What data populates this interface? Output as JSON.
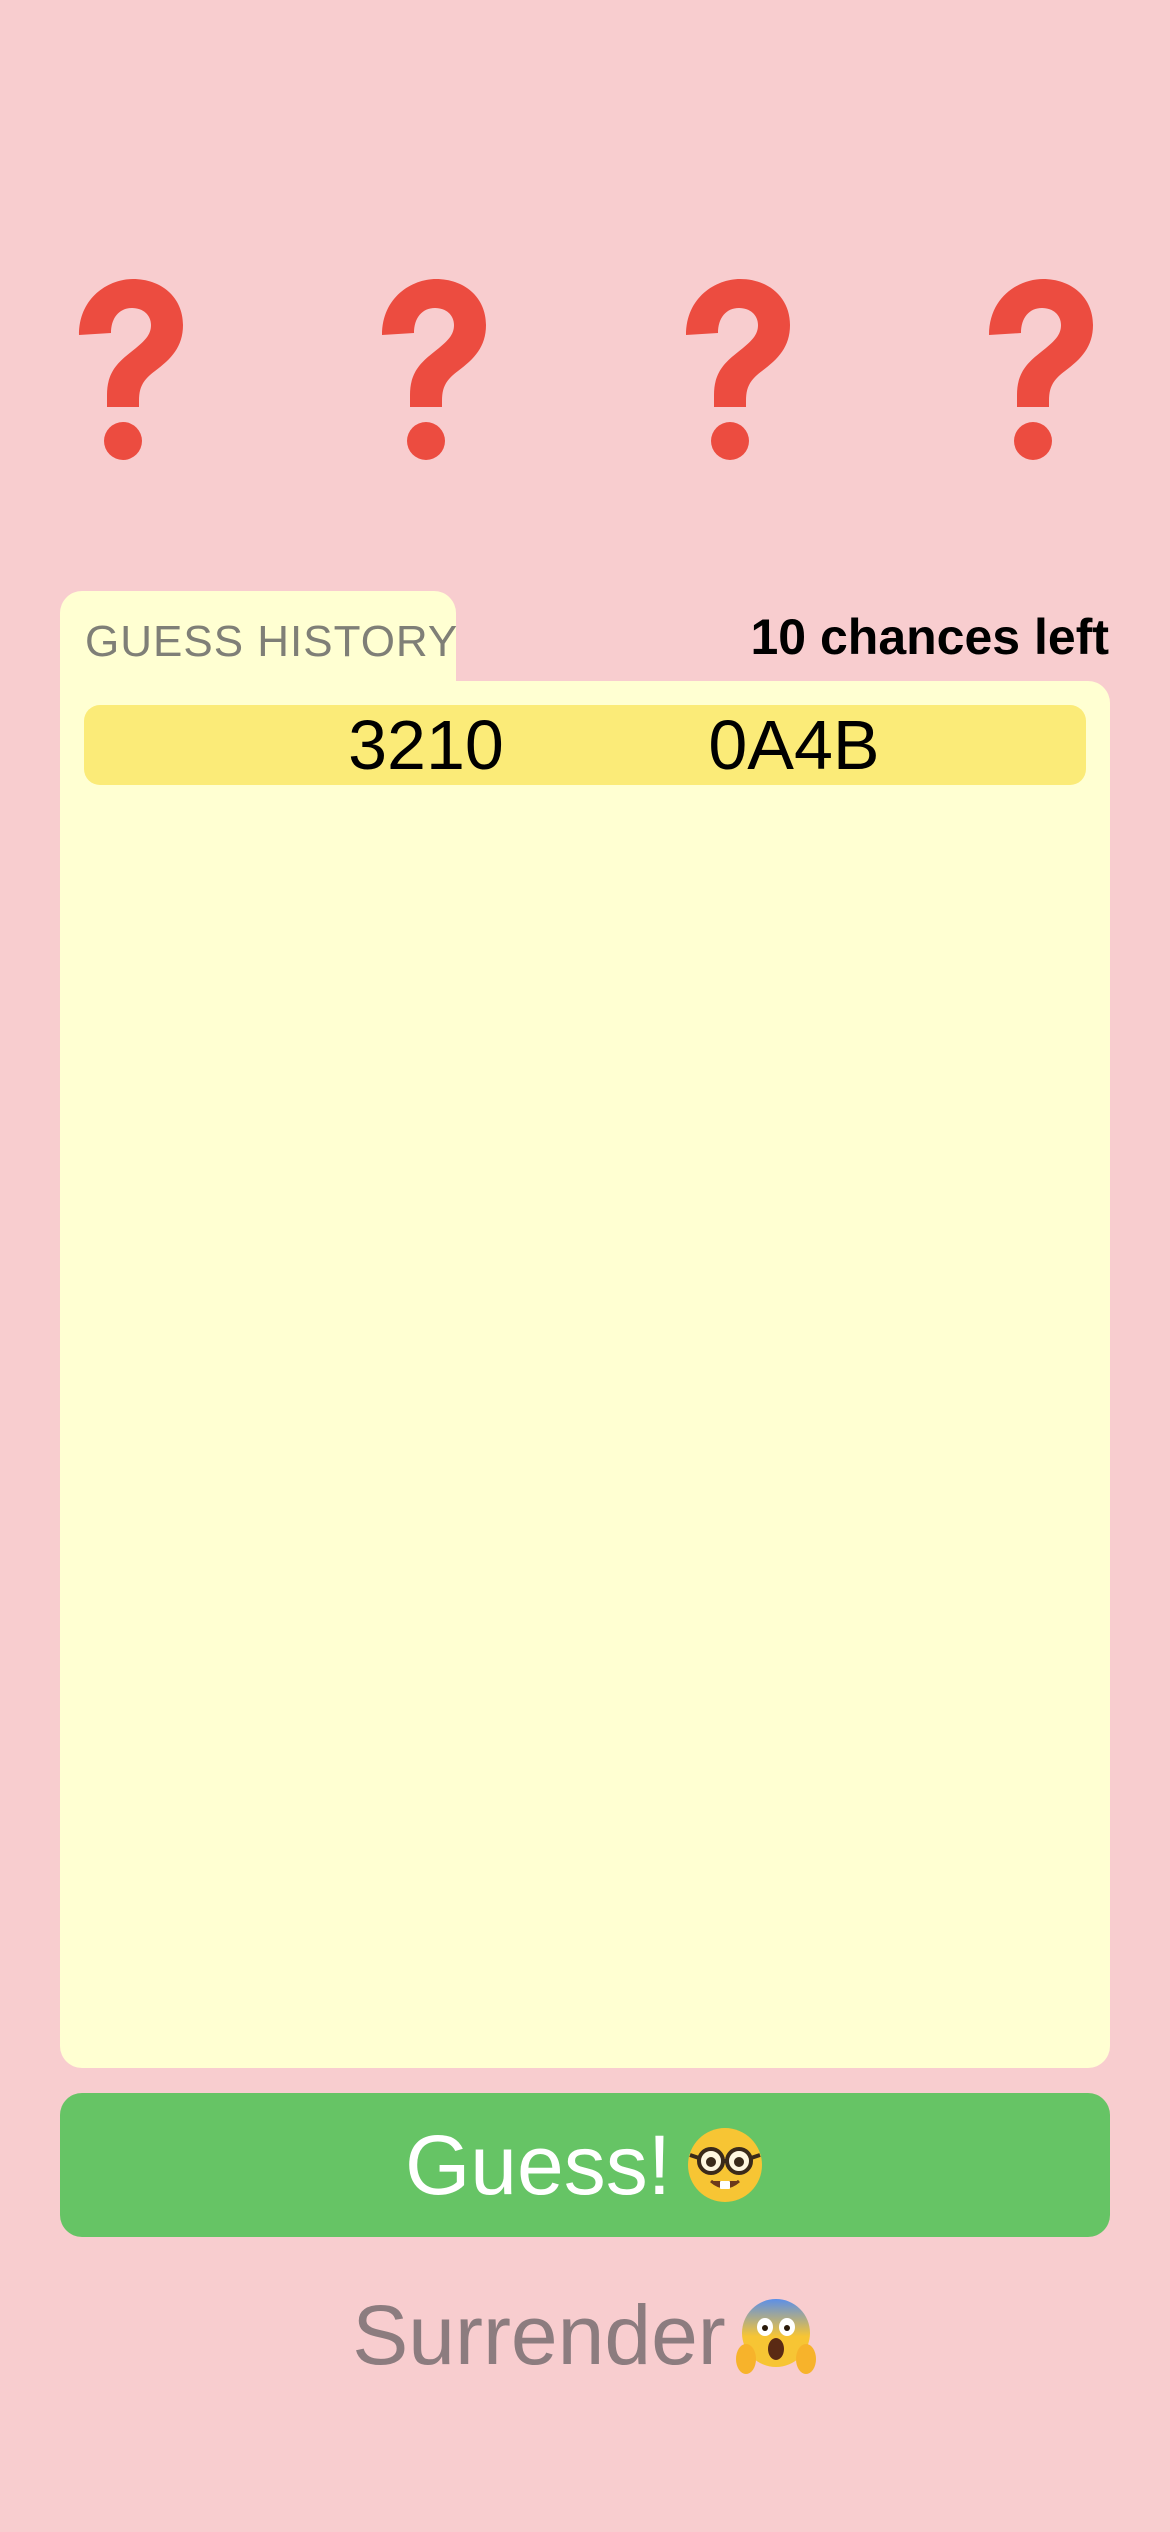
{
  "colors": {
    "background": "#f8cdcf",
    "question_mark": "#ec4c40",
    "panel": "#ffffd2",
    "history_row": "#fbeb78",
    "guess_button": "#66c465",
    "surrender_text": "#8c7c7f"
  },
  "secret": {
    "slots": [
      {
        "icon": "question-mark-icon"
      },
      {
        "icon": "question-mark-icon"
      },
      {
        "icon": "question-mark-icon"
      },
      {
        "icon": "question-mark-icon"
      }
    ]
  },
  "history": {
    "tab_label": "GUESS HISTORY",
    "chances_label": "10 chances left",
    "rows": [
      {
        "guess": "3210",
        "result": "0A4B"
      }
    ]
  },
  "actions": {
    "guess_label": "Guess!",
    "guess_icon": "nerd-face-icon",
    "surrender_label": "Surrender",
    "surrender_icon": "screaming-face-icon"
  }
}
